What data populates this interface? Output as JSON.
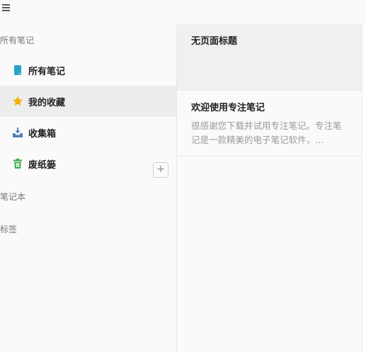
{
  "topbar": {
    "menu_icon": "hamburger-menu-icon"
  },
  "sidebar": {
    "all_notes_header": "所有笔记",
    "items": [
      {
        "label": "所有笔记",
        "icon": "note-icon",
        "color": "#2aa3c9"
      },
      {
        "label": "我的收藏",
        "icon": "star-icon",
        "color": "#f5b000",
        "active": true
      },
      {
        "label": "收集箱",
        "icon": "inbox-download-icon",
        "color": "#4f7fb8"
      },
      {
        "label": "废纸篓",
        "icon": "trash-icon",
        "color": "#3aa84b"
      }
    ],
    "notebooks_header": "笔记本",
    "add_notebook_label": "+",
    "tags_header": "标签"
  },
  "notes": [
    {
      "title": "无页面标题",
      "snippet": "",
      "selected": true
    },
    {
      "title": "欢迎使用专注笔记",
      "snippet": "很感谢您下载并试用专注笔记。专注笔记是一款精美的电子笔记软件，…",
      "selected": false
    }
  ]
}
